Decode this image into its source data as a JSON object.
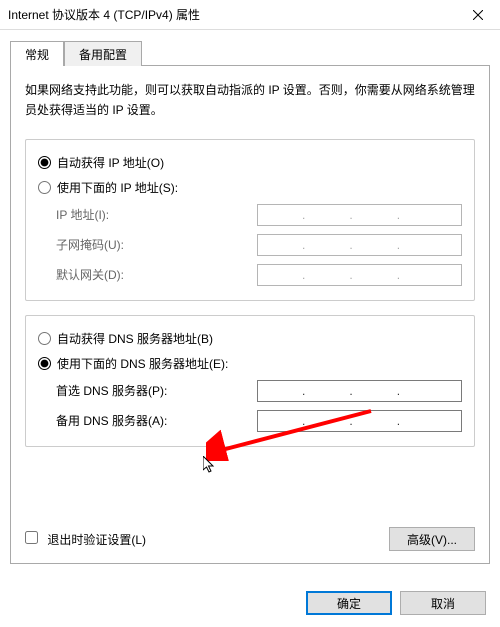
{
  "window": {
    "title": "Internet 协议版本 4 (TCP/IPv4) 属性"
  },
  "tabs": {
    "general": "常规",
    "alternate": "备用配置"
  },
  "description": "如果网络支持此功能，则可以获取自动指派的 IP 设置。否则，你需要从网络系统管理员处获得适当的 IP 设置。",
  "ip_group": {
    "auto": "自动获得 IP 地址(O)",
    "manual": "使用下面的 IP 地址(S):",
    "ip": "IP 地址(I):",
    "subnet": "子网掩码(U):",
    "gateway": "默认网关(D):"
  },
  "dns_group": {
    "auto": "自动获得 DNS 服务器地址(B)",
    "manual": "使用下面的 DNS 服务器地址(E):",
    "preferred": "首选 DNS 服务器(P):",
    "alternate": "备用 DNS 服务器(A):"
  },
  "validate": "退出时验证设置(L)",
  "buttons": {
    "advanced": "高级(V)...",
    "ok": "确定",
    "cancel": "取消"
  }
}
